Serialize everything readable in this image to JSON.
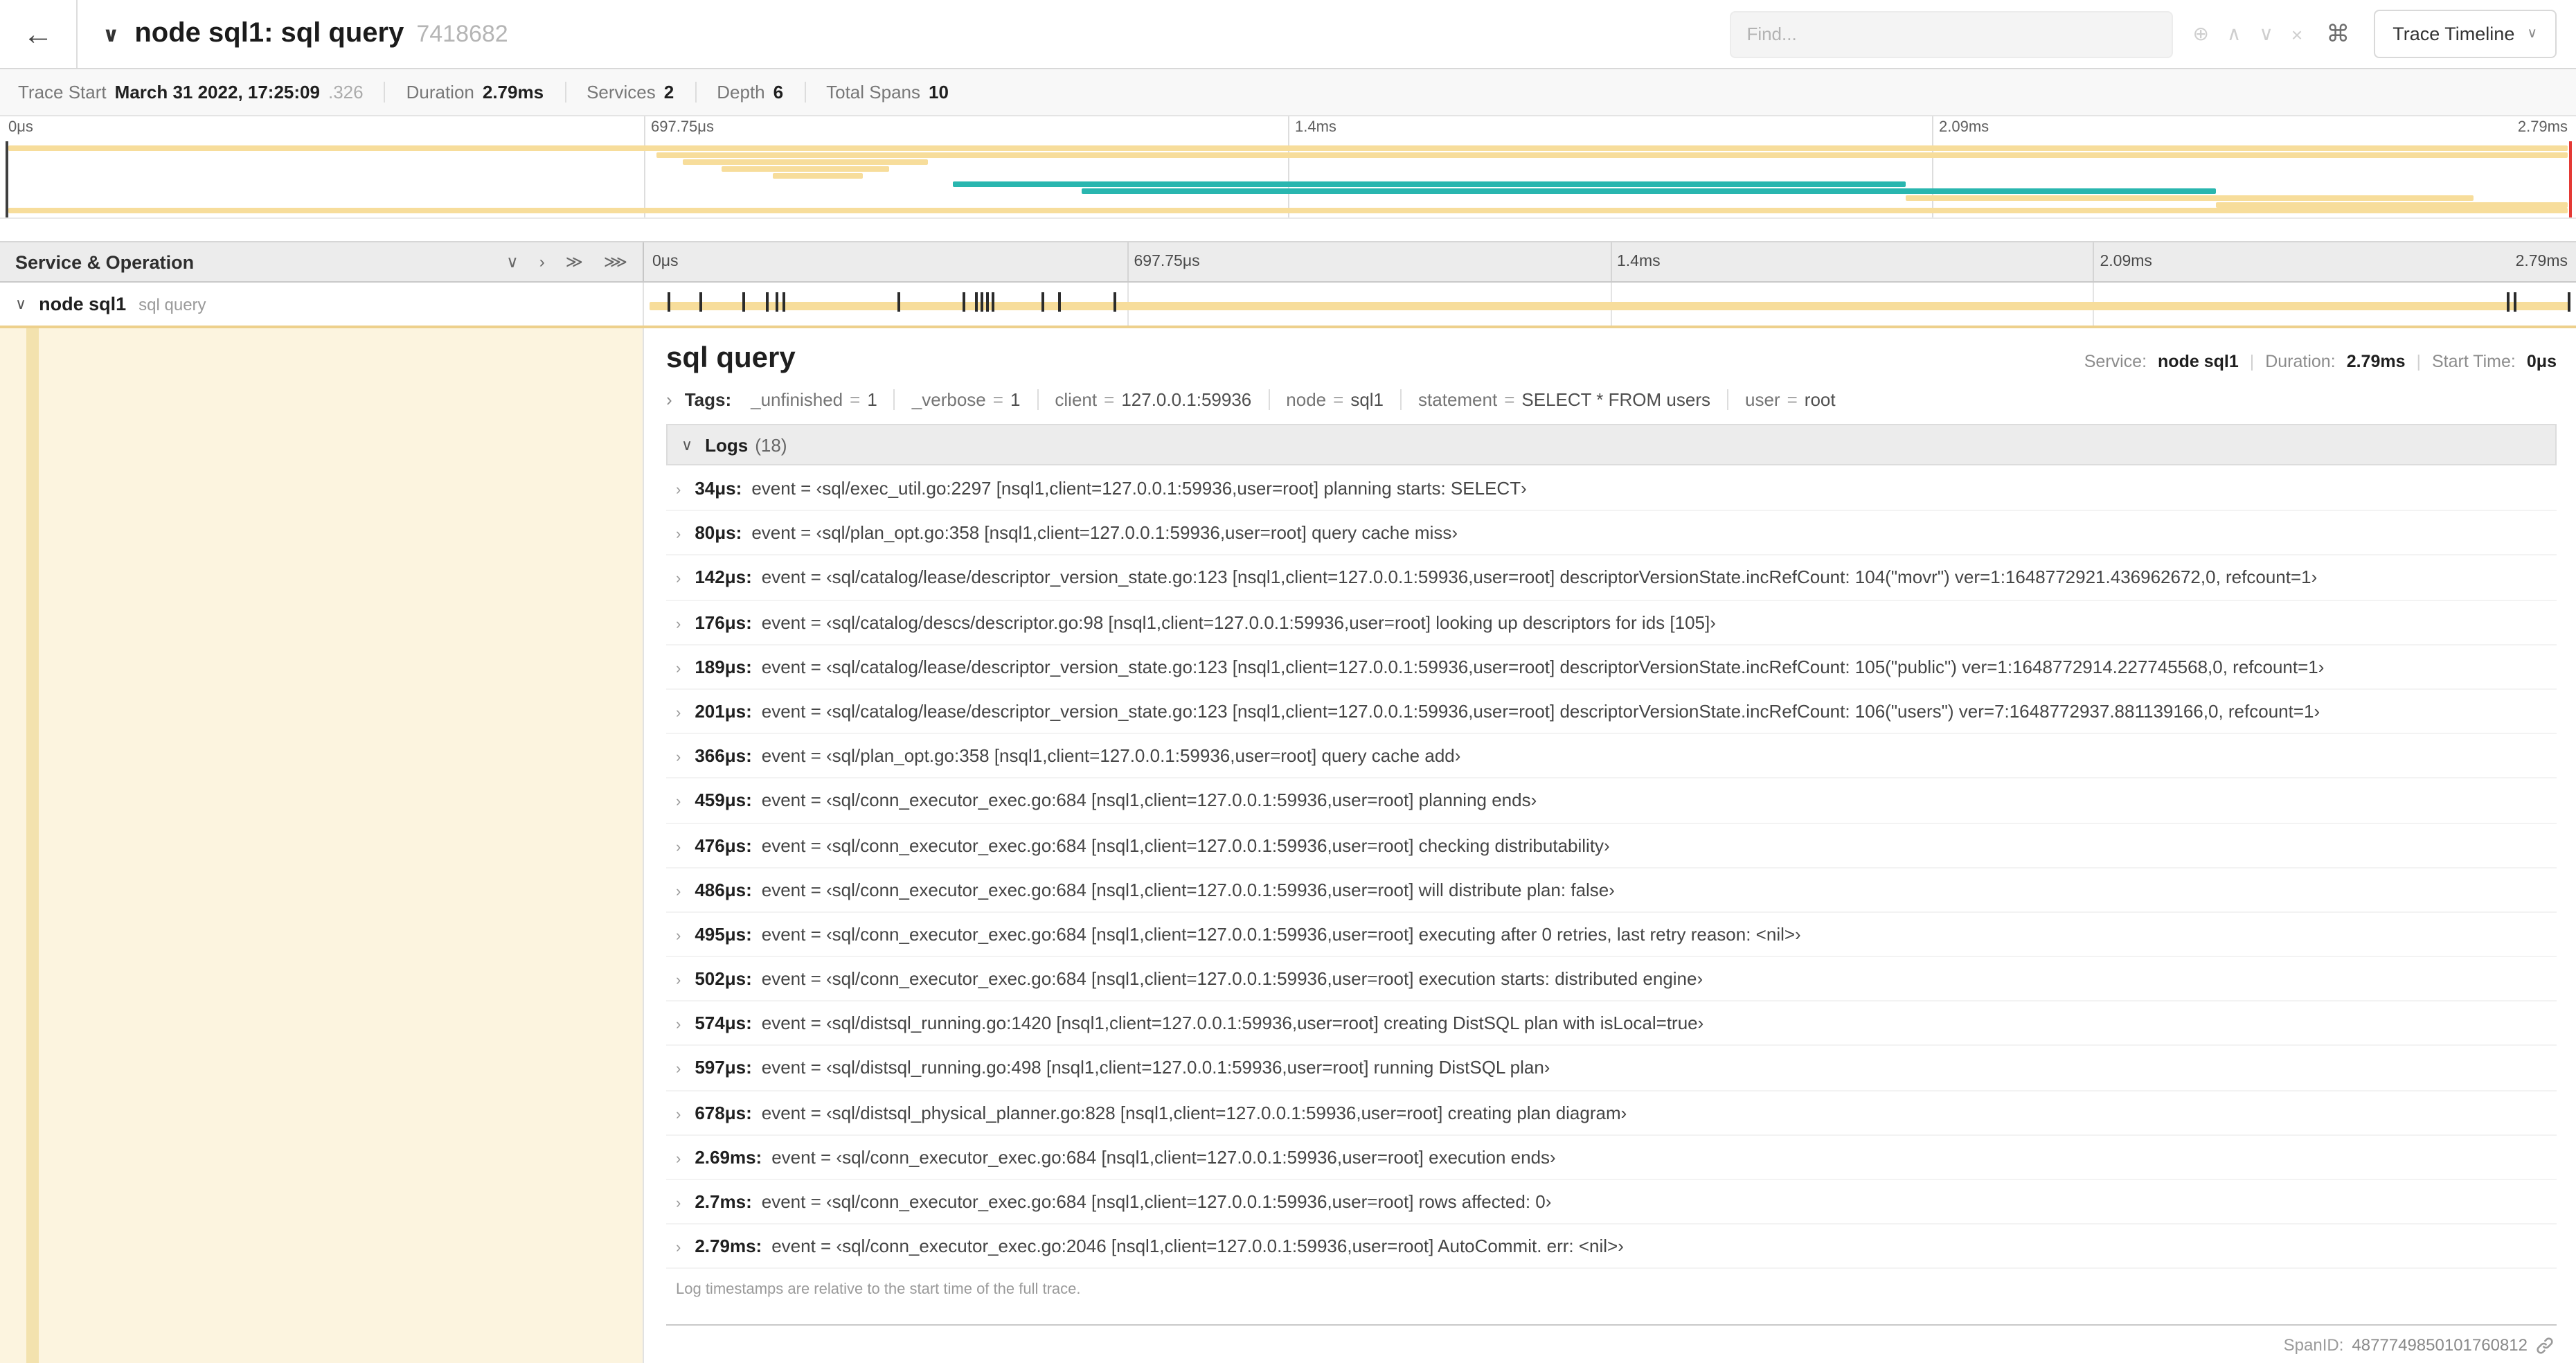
{
  "header": {
    "title": "node sql1: sql query",
    "trace_id": "7418682",
    "find_placeholder": "Find...",
    "view_selector": "Trace Timeline",
    "icons": {
      "back": "←",
      "collapse": "∨",
      "focus": "⊕",
      "prev": "∧",
      "next": "∨",
      "clear": "×",
      "keyboard": "⌘",
      "dropdown": "∨"
    }
  },
  "stats": {
    "trace_start_label": "Trace Start",
    "trace_start_value": "March 31 2022, 17:25:09",
    "trace_start_ms": ".326",
    "duration_label": "Duration",
    "duration_value": "2.79ms",
    "services_label": "Services",
    "services_value": "2",
    "depth_label": "Depth",
    "depth_value": "6",
    "total_spans_label": "Total Spans",
    "total_spans_value": "10"
  },
  "minimap": {
    "ticks": [
      "0μs",
      "697.75μs",
      "1.4ms",
      "2.09ms",
      "2.79ms"
    ],
    "spans": [
      {
        "start": 0.3,
        "end": 99.7,
        "color": "tan"
      },
      {
        "start": 25.5,
        "end": 99.7,
        "color": "tan"
      },
      {
        "start": 26.5,
        "end": 36.0,
        "color": "tan"
      },
      {
        "start": 28.0,
        "end": 34.5,
        "color": "tan"
      },
      {
        "start": 30.0,
        "end": 33.5,
        "color": "tan"
      },
      {
        "start": 37.0,
        "end": 74.0,
        "color": "teal"
      },
      {
        "start": 42.0,
        "end": 86.0,
        "color": "teal"
      },
      {
        "start": 74.0,
        "end": 96.0,
        "color": "tan"
      },
      {
        "start": 86.0,
        "end": 99.7,
        "color": "tan"
      },
      {
        "start": 0.3,
        "end": 99.7,
        "color": "tan"
      }
    ]
  },
  "timeline": {
    "left_header": "Service & Operation",
    "collapse_icons": [
      "∨",
      "›",
      "≫",
      "⋙"
    ],
    "ticks": [
      "0μs",
      "697.75μs",
      "1.4ms",
      "2.09ms",
      "2.79ms"
    ]
  },
  "span_row": {
    "collapse_icon": "∨",
    "service": "node sql1",
    "operation": "sql query",
    "log_tick_positions_pct": [
      1.2,
      2.9,
      5.1,
      6.3,
      6.8,
      7.2,
      13.1,
      16.5,
      17.1,
      17.4,
      17.7,
      18.0,
      20.6,
      21.4,
      24.3,
      96.4,
      96.8,
      99.6
    ]
  },
  "detail": {
    "title": "sql query",
    "chevron_right": "›",
    "chevron_down": "∨",
    "service_label": "Service:",
    "service_value": "node sql1",
    "duration_label": "Duration:",
    "duration_value": "2.79ms",
    "start_label": "Start Time:",
    "start_value": "0μs",
    "tags_label": "Tags:",
    "tags": [
      {
        "key": "_unfinished",
        "value": "1"
      },
      {
        "key": "_verbose",
        "value": "1"
      },
      {
        "key": "client",
        "value": "127.0.0.1:59936"
      },
      {
        "key": "node",
        "value": "sql1"
      },
      {
        "key": "statement",
        "value": "SELECT * FROM users"
      },
      {
        "key": "user",
        "value": "root"
      }
    ],
    "logs_label": "Logs",
    "logs_count": "(18)",
    "logs": [
      {
        "time": "34μs:",
        "text": "event = ‹sql/exec_util.go:2297 [nsql1,client=127.0.0.1:59936,user=root] planning starts: SELECT›"
      },
      {
        "time": "80μs:",
        "text": "event = ‹sql/plan_opt.go:358 [nsql1,client=127.0.0.1:59936,user=root] query cache miss›"
      },
      {
        "time": "142μs:",
        "text": "event = ‹sql/catalog/lease/descriptor_version_state.go:123 [nsql1,client=127.0.0.1:59936,user=root] descriptorVersionState.incRefCount: 104(\"movr\") ver=1:1648772921.436962672,0, refcount=1›"
      },
      {
        "time": "176μs:",
        "text": "event = ‹sql/catalog/descs/descriptor.go:98 [nsql1,client=127.0.0.1:59936,user=root] looking up descriptors for ids [105]›"
      },
      {
        "time": "189μs:",
        "text": "event = ‹sql/catalog/lease/descriptor_version_state.go:123 [nsql1,client=127.0.0.1:59936,user=root] descriptorVersionState.incRefCount: 105(\"public\") ver=1:1648772914.227745568,0, refcount=1›"
      },
      {
        "time": "201μs:",
        "text": "event = ‹sql/catalog/lease/descriptor_version_state.go:123 [nsql1,client=127.0.0.1:59936,user=root] descriptorVersionState.incRefCount: 106(\"users\") ver=7:1648772937.881139166,0, refcount=1›"
      },
      {
        "time": "366μs:",
        "text": "event = ‹sql/plan_opt.go:358 [nsql1,client=127.0.0.1:59936,user=root] query cache add›"
      },
      {
        "time": "459μs:",
        "text": "event = ‹sql/conn_executor_exec.go:684 [nsql1,client=127.0.0.1:59936,user=root] planning ends›"
      },
      {
        "time": "476μs:",
        "text": "event = ‹sql/conn_executor_exec.go:684 [nsql1,client=127.0.0.1:59936,user=root] checking distributability›"
      },
      {
        "time": "486μs:",
        "text": "event = ‹sql/conn_executor_exec.go:684 [nsql1,client=127.0.0.1:59936,user=root] will distribute plan: false›"
      },
      {
        "time": "495μs:",
        "text": "event = ‹sql/conn_executor_exec.go:684 [nsql1,client=127.0.0.1:59936,user=root] executing after 0 retries, last retry reason: <nil>›"
      },
      {
        "time": "502μs:",
        "text": "event = ‹sql/conn_executor_exec.go:684 [nsql1,client=127.0.0.1:59936,user=root] execution starts: distributed engine›"
      },
      {
        "time": "574μs:",
        "text": "event = ‹sql/distsql_running.go:1420 [nsql1,client=127.0.0.1:59936,user=root] creating DistSQL plan with isLocal=true›"
      },
      {
        "time": "597μs:",
        "text": "event = ‹sql/distsql_running.go:498 [nsql1,client=127.0.0.1:59936,user=root] running DistSQL plan›"
      },
      {
        "time": "678μs:",
        "text": "event = ‹sql/distsql_physical_planner.go:828 [nsql1,client=127.0.0.1:59936,user=root] creating plan diagram›"
      },
      {
        "time": "2.69ms:",
        "text": "event = ‹sql/conn_executor_exec.go:684 [nsql1,client=127.0.0.1:59936,user=root] execution ends›"
      },
      {
        "time": "2.7ms:",
        "text": "event = ‹sql/conn_executor_exec.go:684 [nsql1,client=127.0.0.1:59936,user=root] rows affected: 0›"
      },
      {
        "time": "2.79ms:",
        "text": "event = ‹sql/conn_executor_exec.go:2046 [nsql1,client=127.0.0.1:59936,user=root] AutoCommit. err: <nil>›"
      }
    ],
    "footnote": "Log timestamps are relative to the start time of the full trace.",
    "span_id_label": "SpanID:",
    "span_id": "4877749850101760812"
  },
  "colors": {
    "span_tan": "#f7dd9b",
    "span_teal": "#29b6af",
    "scrubber_red": "#e53935",
    "tree_bg": "#fcf4df"
  }
}
